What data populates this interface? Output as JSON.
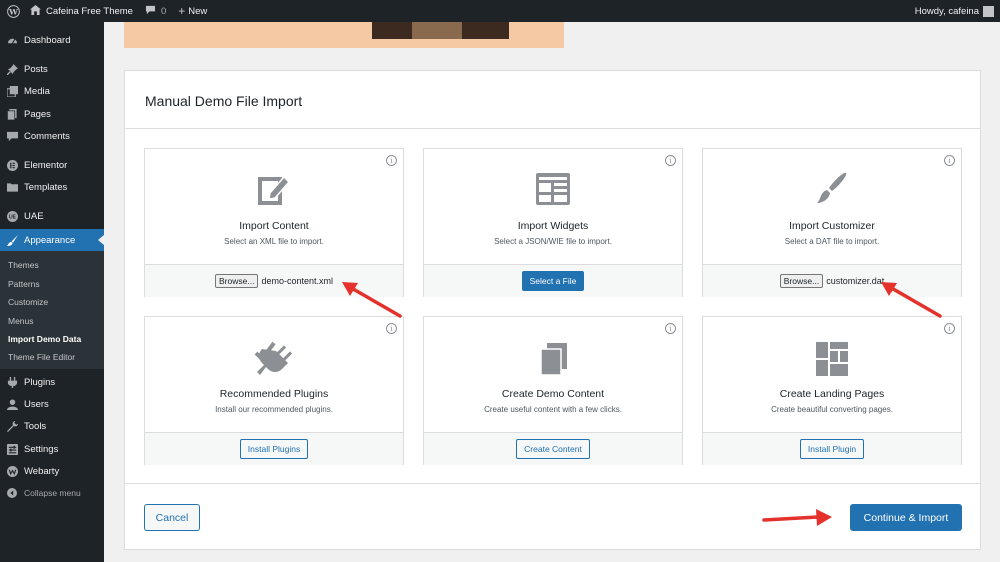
{
  "admin_bar": {
    "site_name": "Cafeina Free Theme",
    "comments_count": "0",
    "new_label": "New",
    "greeting": "Howdy, cafeina"
  },
  "sidebar": {
    "items": [
      {
        "label": "Dashboard",
        "icon": "dashboard-icon"
      },
      {
        "label": "Posts",
        "icon": "pin-icon"
      },
      {
        "label": "Media",
        "icon": "media-icon"
      },
      {
        "label": "Pages",
        "icon": "page-icon"
      },
      {
        "label": "Comments",
        "icon": "comment-icon"
      },
      {
        "label": "Elementor",
        "icon": "elementor-icon"
      },
      {
        "label": "Templates",
        "icon": "folder-icon"
      },
      {
        "label": "UAE",
        "icon": "uae-icon"
      },
      {
        "label": "Appearance",
        "icon": "brush-icon"
      },
      {
        "label": "Plugins",
        "icon": "plugin-icon"
      },
      {
        "label": "Users",
        "icon": "users-icon"
      },
      {
        "label": "Tools",
        "icon": "wrench-icon"
      },
      {
        "label": "Settings",
        "icon": "settings-icon"
      },
      {
        "label": "Webarty",
        "icon": "webarty-icon"
      }
    ],
    "submenu": [
      "Themes",
      "Patterns",
      "Customize",
      "Menus",
      "Import Demo Data",
      "Theme File Editor"
    ],
    "collapse_label": "Collapse menu"
  },
  "main": {
    "title": "Manual Demo File Import",
    "boxes": [
      {
        "title": "Import Content",
        "desc": "Select an XML file to import.",
        "browse_label": "Browse...",
        "file_name": "demo-content.xml",
        "icon": "edit-document-icon"
      },
      {
        "title": "Import Widgets",
        "desc": "Select a JSON/WIE file to import.",
        "button_label": "Select a File",
        "icon": "widgets-grid-icon"
      },
      {
        "title": "Import Customizer",
        "desc": "Select a DAT file to import.",
        "browse_label": "Browse...",
        "file_name": "customizer.dat",
        "icon": "paintbrush-icon"
      },
      {
        "title": "Recommended Plugins",
        "desc": "Install our recommended plugins.",
        "button_label": "Install Plugins",
        "icon": "plug-check-icon"
      },
      {
        "title": "Create Demo Content",
        "desc": "Create useful content with a few clicks.",
        "button_label": "Create Content",
        "icon": "copy-pages-icon"
      },
      {
        "title": "Create Landing Pages",
        "desc": "Create beautiful converting pages.",
        "button_label": "Install Plugin",
        "icon": "layout-icon"
      }
    ],
    "info_glyph": "i",
    "cancel_label": "Cancel",
    "import_label": "Continue & Import"
  },
  "colors": {
    "accent": "#2271b1",
    "sidebar_bg": "#1d2327",
    "annotation_arrow": "#e5312b"
  }
}
